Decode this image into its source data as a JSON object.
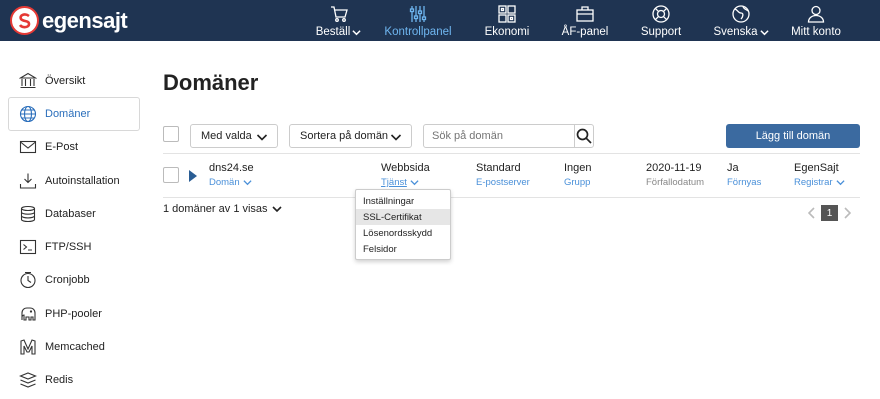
{
  "brand": {
    "name": "egensajt"
  },
  "nav": [
    {
      "label": "Beställ",
      "icon": "cart-icon",
      "chevron": true
    },
    {
      "label": "Kontrollpanel",
      "icon": "sliders-icon",
      "active": true
    },
    {
      "label": "Ekonomi",
      "icon": "grid-icon"
    },
    {
      "label": "ÅF-panel",
      "icon": "briefcase-icon"
    },
    {
      "label": "Support",
      "icon": "lifebuoy-icon"
    },
    {
      "label": "Svenska",
      "icon": "globe-icon",
      "chevron": true
    },
    {
      "label": "Mitt konto",
      "icon": "user-icon"
    }
  ],
  "sidebar": {
    "items": [
      {
        "label": "Översikt",
        "icon": "bank-icon"
      },
      {
        "label": "Domäner",
        "icon": "globe-icon",
        "active": true
      },
      {
        "label": "E-Post",
        "icon": "mail-icon"
      },
      {
        "label": "Autoinstallation",
        "icon": "download-icon"
      },
      {
        "label": "Databaser",
        "icon": "database-icon"
      },
      {
        "label": "FTP/SSH",
        "icon": "terminal-icon"
      },
      {
        "label": "Cronjobb",
        "icon": "clock-icon"
      },
      {
        "label": "PHP-pooler",
        "icon": "elephant-icon"
      },
      {
        "label": "Memcached",
        "icon": "memcached-icon"
      },
      {
        "label": "Redis",
        "icon": "stack-icon"
      }
    ]
  },
  "page": {
    "title": "Domäner"
  },
  "toolbar": {
    "bulk_label": "Med valda",
    "sort_label": "Sortera på domän",
    "search_placeholder": "Sök på domän",
    "add_label": "Lägg till domän"
  },
  "row": {
    "domain": "dns24.se",
    "domain_sub": "Domän",
    "service": "Webbsida",
    "service_sub": "Tjänst",
    "mailserver": "Standard",
    "mailserver_sub": "E-postserver",
    "group": "Ingen",
    "group_sub": "Grupp",
    "expiry": "2020-11-19",
    "expiry_sub": "Förfallodatum",
    "renew": "Ja",
    "renew_sub": "Förnyas",
    "registrar": "EgenSajt",
    "registrar_sub": "Registrar"
  },
  "dropdown": {
    "items": [
      "Inställningar",
      "SSL-Certifikat",
      "Lösenordsskydd",
      "Felsidor"
    ],
    "highlighted": 1
  },
  "footer": {
    "count_label": "1 domäner av 1 visas"
  },
  "pager": {
    "current": "1"
  },
  "colors": {
    "topbar": "#1f3452",
    "accent": "#6fb6f0",
    "primary_button": "#3b6aa0",
    "link": "#4a90d9"
  }
}
